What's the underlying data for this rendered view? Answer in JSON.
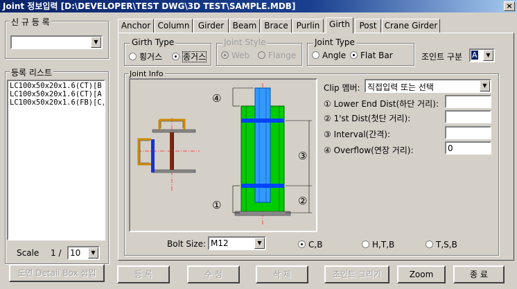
{
  "window": {
    "title": "Joint 정보입력  [D:\\DEVELOPER\\TEST DWG\\3D TEST\\SAMPLE.MDB]",
    "close": "×"
  },
  "left": {
    "new_group": "신 규 등 록",
    "list_group": "등록 리스트",
    "list_items": [
      "LC100x50x20x1.6(CT)[B",
      "LC100x50x20x1.6(CT)[A",
      "LC100x50x20x1.6(FB)[C,"
    ],
    "scale_label": "Scale",
    "scale_prefix": "1 /",
    "scale_value": "10",
    "detail_button": "도면 Detail Box 삽입"
  },
  "tabs": [
    "Anchor",
    "Column",
    "Girder",
    "Beam",
    "Brace",
    "Purlin",
    "Girth",
    "Post",
    "Crane Girder"
  ],
  "active_tab": "Girth",
  "girth_type": {
    "label": "Girth Type",
    "opt1": "횡거스",
    "opt2": "종거스"
  },
  "joint_style": {
    "label": "Joint Style",
    "opt1": "Web",
    "opt2": "Flange"
  },
  "joint_type": {
    "label": "Joint Type",
    "opt1": "Angle",
    "opt2": "Flat Bar"
  },
  "joint_gubun": {
    "label": "조인트 구분",
    "value": "A"
  },
  "joint_info": {
    "label": "Joint Info",
    "clip_label": "Clip 멤버:",
    "clip_value": "직접입력 또는 선택",
    "f1": "① Lower End Dist(하단 거리):",
    "f2": "② 1'st Dist(첫단 거리):",
    "f3": "③ Interval(간격):",
    "f4": "④ Overflow(연장 거리):",
    "f4_value": "0",
    "bolt_label": "Bolt Size:",
    "bolt_value": "M12",
    "r1": "C,B",
    "r2": "H,T,B",
    "r3": "T,S,B",
    "marks": [
      "④",
      "③",
      "②",
      "①"
    ]
  },
  "bottom_buttons": [
    "등  록",
    "수  정",
    "삭  제",
    "조인트 그리기",
    "Zoom",
    "종  료"
  ],
  "colors": {
    "title_start": "#0a246a",
    "column_blue": "#3399ff",
    "plate_green": "#00cc00",
    "bolt_blue": "#0044ff"
  }
}
